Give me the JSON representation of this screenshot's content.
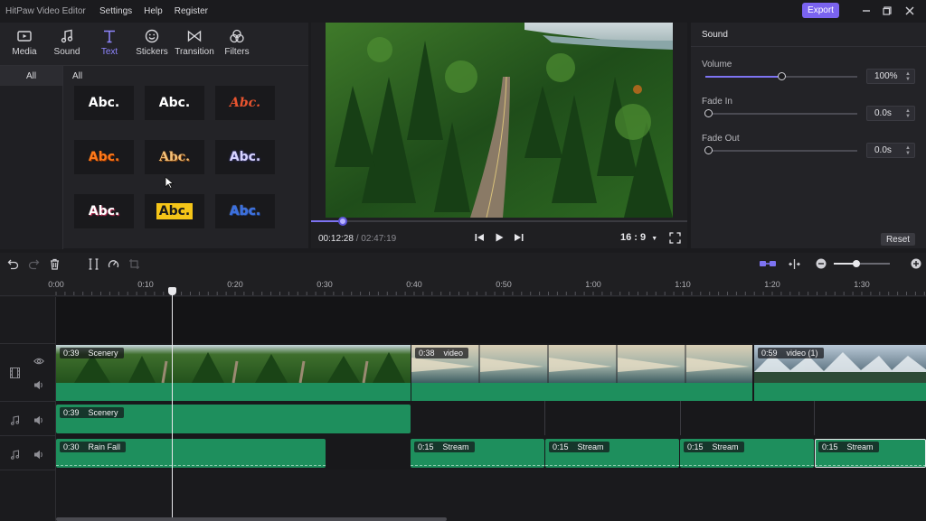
{
  "app": {
    "title": "HitPaw Video Editor",
    "menu": [
      "Settings",
      "Help",
      "Register"
    ],
    "export_label": "Export"
  },
  "tool_tabs": [
    {
      "label": "Media",
      "icon": "media-icon"
    },
    {
      "label": "Sound",
      "icon": "music-note-icon"
    },
    {
      "label": "Text",
      "icon": "text-icon",
      "active": true
    },
    {
      "label": "Stickers",
      "icon": "sticker-icon"
    },
    {
      "label": "Transition",
      "icon": "transition-icon"
    },
    {
      "label": "Filters",
      "icon": "filters-icon"
    }
  ],
  "text_panel": {
    "category": "All",
    "grid_title": "All",
    "styles": [
      {
        "text": "Abc.",
        "color": "#ffffff",
        "style": "plain-white"
      },
      {
        "text": "Abc.",
        "color": "#ffffff",
        "style": "plain-white-2"
      },
      {
        "text": "Abc.",
        "color": "#e8542f",
        "style": "red-script"
      },
      {
        "text": "Abc.",
        "color": "#ff7a1a",
        "style": "orange-bold"
      },
      {
        "text": "Abc.",
        "color": "#f5c27a",
        "style": "gold-outline"
      },
      {
        "text": "Abc.",
        "color": "#d8d4ff",
        "style": "lavender-outline"
      },
      {
        "text": "Abc.",
        "color": "#ffffff",
        "style": "white-shadow"
      },
      {
        "text": "Abc.",
        "color": "#1a1a1a",
        "style": "yellow-box"
      },
      {
        "text": "Abc.",
        "color": "#3a6fe0",
        "style": "blue-outline"
      }
    ]
  },
  "preview": {
    "current_time": "00:12:28",
    "separator": "/",
    "total_time": "02:47:19",
    "progress": 0.085,
    "aspect_ratio": "16 : 9"
  },
  "sound": {
    "title": "Sound",
    "volume": {
      "label": "Volume",
      "value": "100%",
      "level": 0.5
    },
    "fade_in": {
      "label": "Fade In",
      "value": "0.0s",
      "level": 0
    },
    "fade_out": {
      "label": "Fade Out",
      "value": "0.0s",
      "level": 0
    },
    "reset_label": "Reset"
  },
  "timeline": {
    "ruler_ticks": [
      "0:00",
      "0:10",
      "0:20",
      "0:30",
      "0:40",
      "0:50",
      "1:00",
      "1:10",
      "1:20",
      "1:30"
    ],
    "video_clips": [
      {
        "duration": "0:39",
        "name": "Scenery"
      },
      {
        "duration": "0:38",
        "name": "video"
      },
      {
        "duration": "0:59",
        "name": "video (1)"
      }
    ],
    "audio_track_1": [
      {
        "duration": "0:39",
        "name": "Scenery"
      }
    ],
    "audio_track_2": [
      {
        "duration": "0:30",
        "name": "Rain Fall"
      },
      {
        "duration": "0:15",
        "name": "Stream"
      },
      {
        "duration": "0:15",
        "name": "Stream"
      },
      {
        "duration": "0:15",
        "name": "Stream"
      },
      {
        "duration": "0:15",
        "name": "Stream",
        "selected": true
      }
    ],
    "zoom_level": 0.38
  }
}
